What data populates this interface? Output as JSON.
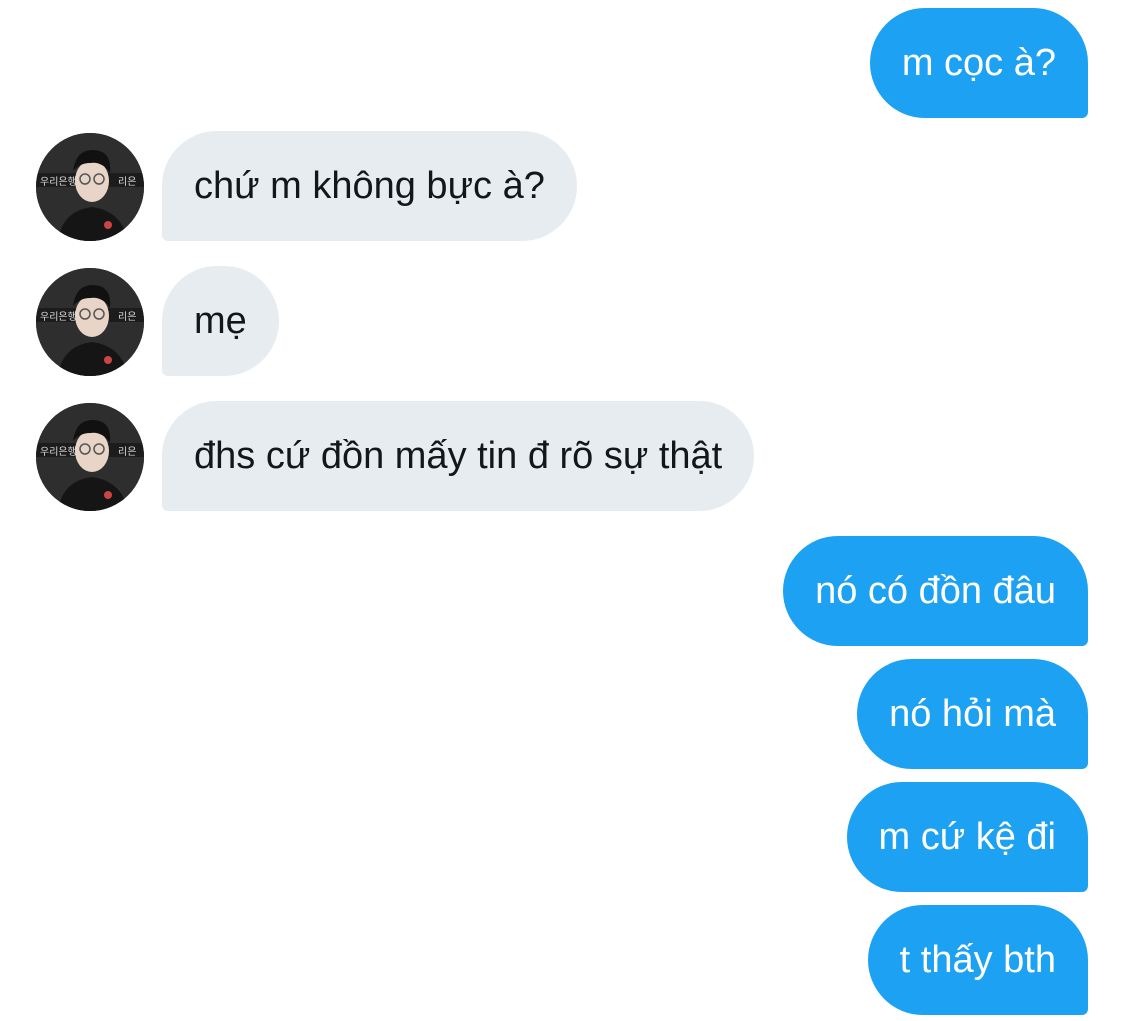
{
  "conversation": {
    "messages": [
      {
        "direction": "outgoing",
        "text": "m cọc à?"
      },
      {
        "direction": "incoming",
        "text": "chứ m không bực à?",
        "avatar": "user-avatar-photo"
      },
      {
        "direction": "incoming",
        "text": "mẹ",
        "avatar": "user-avatar-photo"
      },
      {
        "direction": "incoming",
        "text": "đhs cứ đồn mấy tin đ rõ sự thật",
        "avatar": "user-avatar-photo"
      },
      {
        "direction": "outgoing",
        "text": "nó có đồn đâu"
      },
      {
        "direction": "outgoing",
        "text": "nó hỏi mà"
      },
      {
        "direction": "outgoing",
        "text": "m cứ kệ đi"
      },
      {
        "direction": "outgoing",
        "text": "t thấy bth"
      }
    ]
  },
  "colors": {
    "outgoing_bubble": "#1da1f2",
    "incoming_bubble": "#e6ecf0",
    "outgoing_text": "#ffffff",
    "incoming_text": "#14171a",
    "background": "#ffffff"
  }
}
